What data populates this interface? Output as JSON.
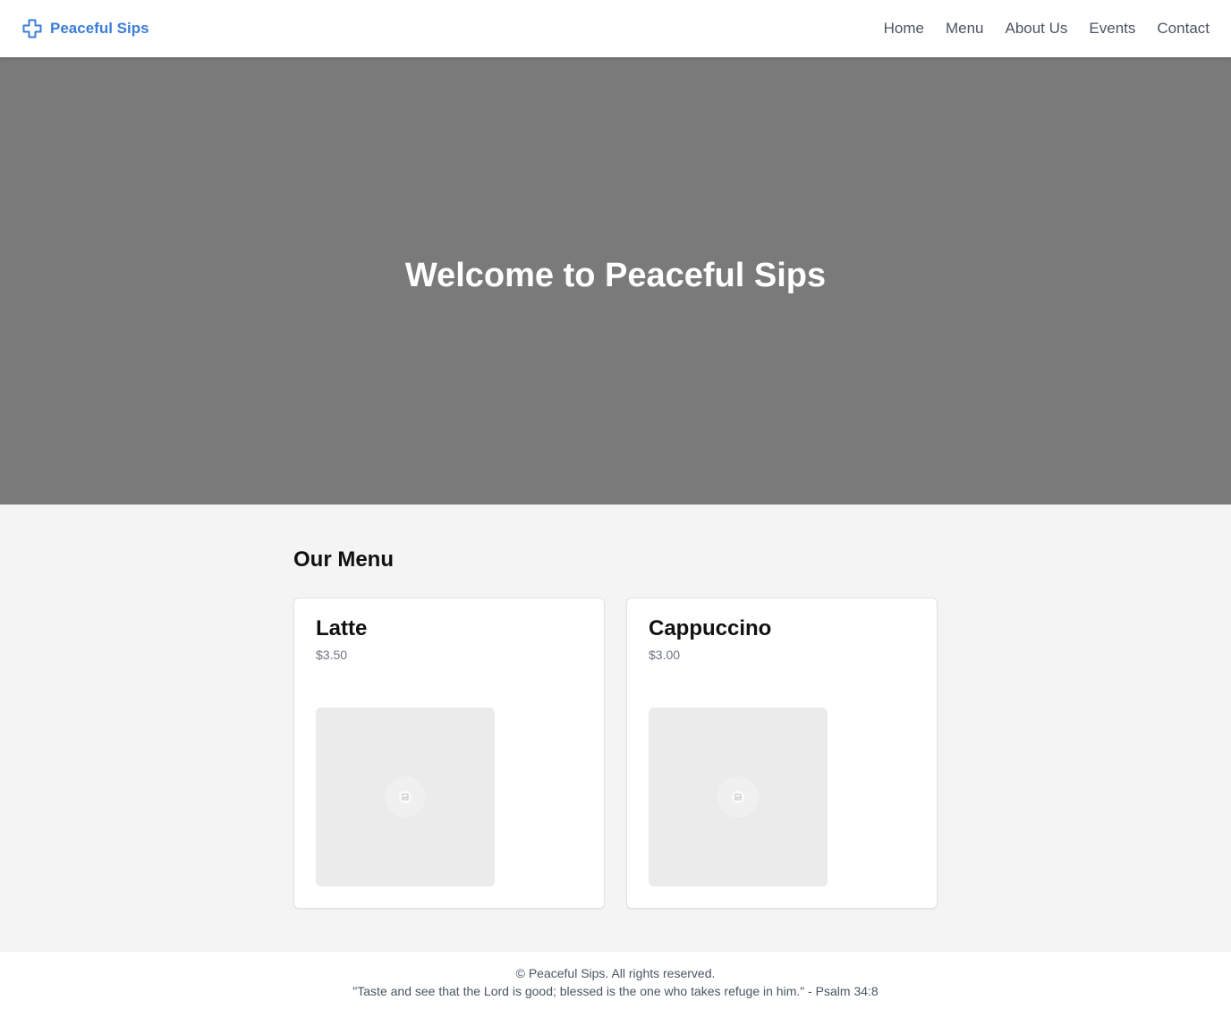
{
  "header": {
    "brand_name": "Peaceful Sips",
    "brand_icon": "cross-icon",
    "brand_color": "#3b7dd8",
    "nav": [
      {
        "label": "Home"
      },
      {
        "label": "Menu"
      },
      {
        "label": "About Us"
      },
      {
        "label": "Events"
      },
      {
        "label": "Contact"
      }
    ]
  },
  "hero": {
    "title": "Welcome to Peaceful Sips",
    "background_color": "#7a7a7a"
  },
  "menu": {
    "heading": "Our Menu",
    "items": [
      {
        "name": "Latte",
        "price": "$3.50",
        "image_icon": "image-placeholder-icon"
      },
      {
        "name": "Cappuccino",
        "price": "$3.00",
        "image_icon": "image-placeholder-icon"
      }
    ]
  },
  "footer": {
    "copyright": "© Peaceful Sips. All rights reserved.",
    "verse": "\"Taste and see that the Lord is good; blessed is the one who takes refuge in him.\" - Psalm 34:8"
  }
}
